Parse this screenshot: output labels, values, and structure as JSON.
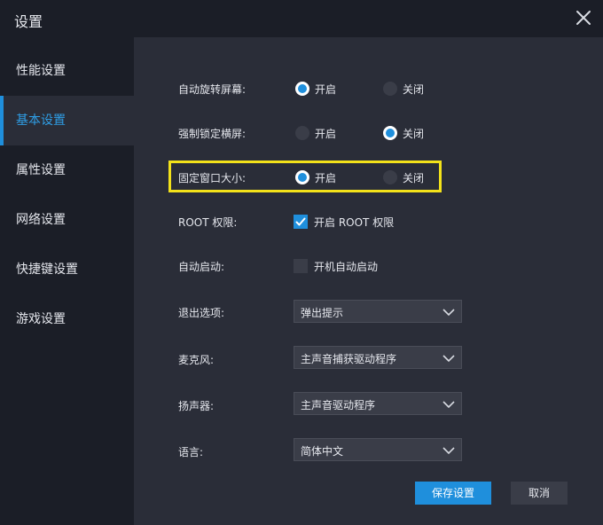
{
  "window": {
    "title": "设置"
  },
  "sidebar": {
    "items": [
      {
        "label": "性能设置",
        "active": false
      },
      {
        "label": "基本设置",
        "active": true
      },
      {
        "label": "属性设置",
        "active": false
      },
      {
        "label": "网络设置",
        "active": false
      },
      {
        "label": "快捷键设置",
        "active": false
      },
      {
        "label": "游戏设置",
        "active": false
      }
    ]
  },
  "settings": {
    "auto_rotate": {
      "label": "自动旋转屏幕:",
      "on_label": "开启",
      "off_label": "关闭",
      "value": "on"
    },
    "force_landscape": {
      "label": "强制锁定横屏:",
      "on_label": "开启",
      "off_label": "关闭",
      "value": "off"
    },
    "fixed_window": {
      "label": "固定窗口大小:",
      "on_label": "开启",
      "off_label": "关闭",
      "value": "on"
    },
    "root": {
      "label": "ROOT 权限:",
      "checkbox_label": "开启 ROOT 权限",
      "checked": true
    },
    "autostart": {
      "label": "自动启动:",
      "checkbox_label": "开机自动启动",
      "checked": false
    },
    "exit_option": {
      "label": "退出选项:",
      "value": "弹出提示"
    },
    "microphone": {
      "label": "麦克风:",
      "value": "主声音捕获驱动程序"
    },
    "speaker": {
      "label": "扬声器:",
      "value": "主声音驱动程序"
    },
    "language": {
      "label": "语言:",
      "value": "简体中文"
    }
  },
  "buttons": {
    "save": "保存设置",
    "cancel": "取消"
  },
  "colors": {
    "accent": "#1f8fdc",
    "highlight": "#f3e21a",
    "panel": "#2a2d38",
    "background": "#1b1e27"
  }
}
